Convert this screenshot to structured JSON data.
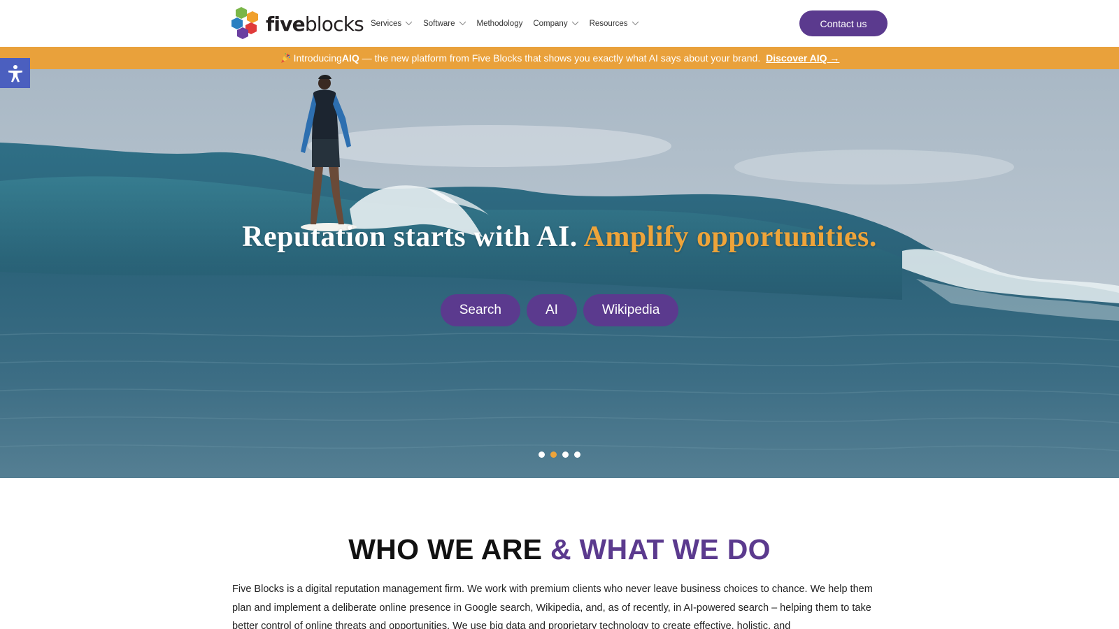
{
  "header": {
    "logo": {
      "text_bold": "five",
      "text_light": "blocks"
    },
    "nav": [
      {
        "label": "Services",
        "dropdown": true
      },
      {
        "label": "Software",
        "dropdown": true
      },
      {
        "label": "Methodology",
        "dropdown": false
      },
      {
        "label": "Company",
        "dropdown": true
      },
      {
        "label": "Resources",
        "dropdown": true
      }
    ],
    "contact_label": "Contact us"
  },
  "announcement": {
    "icon": "party-popper-icon",
    "prefix": "Introducing ",
    "product": "AIQ",
    "text": " — the new platform from Five Blocks that shows you exactly what AI says about your brand. ",
    "link": "Discover AIQ →"
  },
  "accessibility": {
    "icon": "accessibility-person-icon"
  },
  "hero": {
    "title_white": "Reputation starts with AI. ",
    "title_accent": "Amplify opportunities.",
    "pills": [
      "Search",
      "AI",
      "Wikipedia"
    ],
    "slides": 4,
    "active_slide": 2
  },
  "who": {
    "title_black": "WHO WE ARE ",
    "title_purple": "& WHAT WE DO",
    "paragraph": "Five Blocks is a digital reputation management firm. We work with premium clients who never leave business choices to chance. We help them plan and implement a deliberate online presence in Google search, Wikipedia, and, as of recently, in AI-powered search – helping them to take better control of online threats and opportunities. We use big data and proprietary technology to create effective, holistic, and"
  },
  "colors": {
    "brand_purple": "#5b3a8e",
    "accent_orange": "#e9a13b",
    "accessibility_blue": "#4b5fbf"
  }
}
